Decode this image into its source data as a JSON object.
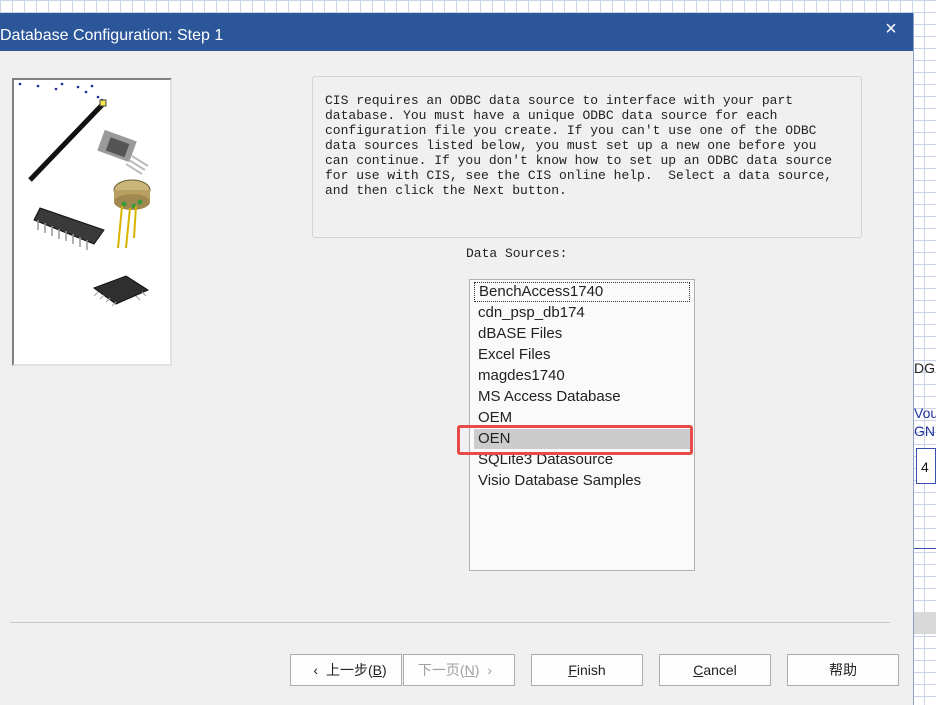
{
  "background": {
    "text1": "DG",
    "text2": "Vou",
    "text3": "GND",
    "box_value": "4"
  },
  "dialog": {
    "title": "Database Configuration: Step 1",
    "close_glyph": "×"
  },
  "info": {
    "text": "CIS requires an ODBC data source to interface with your part\ndatabase. You must have a unique ODBC data source for each\nconfiguration file you create. If you can't use one of the ODBC\ndata sources listed below, you must set up a new one before you\ncan continue. If you don't know how to set up an ODBC data source\nfor use with CIS, see the CIS online help.  Select a data source,\nand then click the Next button."
  },
  "data_sources": {
    "label": "Data Sources:",
    "items": [
      "BenchAccess1740",
      "cdn_psp_db174",
      "dBASE Files",
      "Excel Files",
      "magdes1740",
      "MS Access Database",
      "OEM",
      "OEN",
      "SQLite3 Datasource",
      "Visio Database Samples"
    ],
    "selected": "OEN",
    "focused": "BenchAccess1740"
  },
  "buttons": {
    "back": {
      "chev": "‹",
      "label": "上一步(",
      "key": "B",
      "end": ")"
    },
    "next": {
      "label": "下一页(",
      "key": "N",
      "end": ")",
      "chev": "›"
    },
    "finish": {
      "key": "F",
      "rest": "inish"
    },
    "cancel": {
      "key": "C",
      "rest": "ancel"
    },
    "help": {
      "label": "帮助"
    }
  },
  "colors": {
    "titlebar": "#2b579a",
    "highlight": "#e84a4a",
    "selected_row": "#cccccc"
  }
}
